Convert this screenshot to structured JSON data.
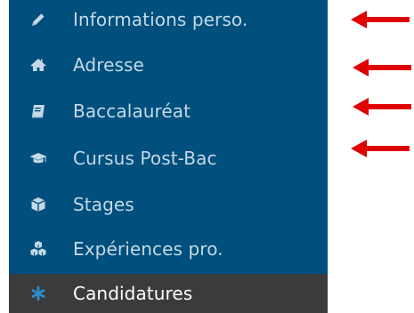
{
  "sidebar": {
    "background": "#004f7d",
    "text_color": "#c3d9e6",
    "active_background": "#3b3b3b",
    "active_icon_color": "#2a8fd0",
    "items": [
      {
        "label": "Informations perso.",
        "icon": "pencil-icon",
        "active": false
      },
      {
        "label": "Adresse",
        "icon": "home-icon",
        "active": false
      },
      {
        "label": "Baccalauréat",
        "icon": "book-icon",
        "active": false
      },
      {
        "label": "Cursus Post-Bac",
        "icon": "graduation-cap-icon",
        "active": false
      },
      {
        "label": "Stages",
        "icon": "cube-icon",
        "active": false
      },
      {
        "label": "Expériences pro.",
        "icon": "cubes-icon",
        "active": false
      },
      {
        "label": "Candidatures",
        "icon": "asterisk-icon",
        "active": true
      }
    ]
  },
  "annotations": {
    "arrow_color": "#e00000",
    "arrows": [
      {
        "points_to": "Informations perso."
      },
      {
        "points_to": "Adresse"
      },
      {
        "points_to": "Baccalauréat"
      },
      {
        "points_to": "Cursus Post-Bac"
      }
    ]
  }
}
